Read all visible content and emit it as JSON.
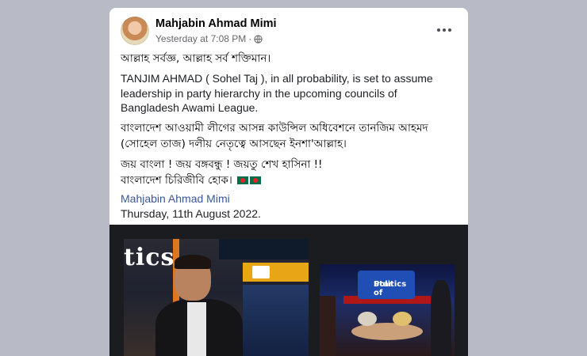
{
  "post": {
    "author": "Mahjabin Ahmad Mimi",
    "timestamp": "Yesterday at 7:08 PM",
    "separator": "·",
    "privacy_icon": "globe-icon",
    "more_icon": "more-options-icon",
    "lines": {
      "bn_1": "আল্লাহ সর্বজ্ঞ, আল্লাহ সর্ব শক্তিমান।",
      "en_1": "TANJIM AHMAD ( Sohel Taj ), in all probability, is set to assume leadership in party hierarchy in the upcoming councils of Bangladesh Awami League.",
      "bn_2": "বাংলাদেশ আওয়ামী লীগের আসন্ন কাউন্সিল অধিবেশনে তানজিম আহমদ (সোহেল তাজ) দলীয় নেতৃত্বে আসছেন ইনশা'আল্লাহ।",
      "bn_3a": "জয় বাংলা ! জয় বঙ্গবন্ধু ! জয়তু শেখ হাসিনা !!",
      "bn_3b": "বাংলাদেশ চিরিজীবি হোক।"
    },
    "signature_name": "Mahjabin Ahmad Mimi",
    "signature_date": "Thursday, 11th August 2022."
  },
  "media": {
    "image1_wordmark": "tics",
    "image2_logo_line1": "Star of",
    "image2_logo_line2": "Politics"
  },
  "colors": {
    "page_bg": "#b8bac6",
    "card_bg": "#ffffff",
    "link": "#385898",
    "muted": "#65676b",
    "flag_green": "#00704a",
    "flag_red": "#e8202a"
  }
}
